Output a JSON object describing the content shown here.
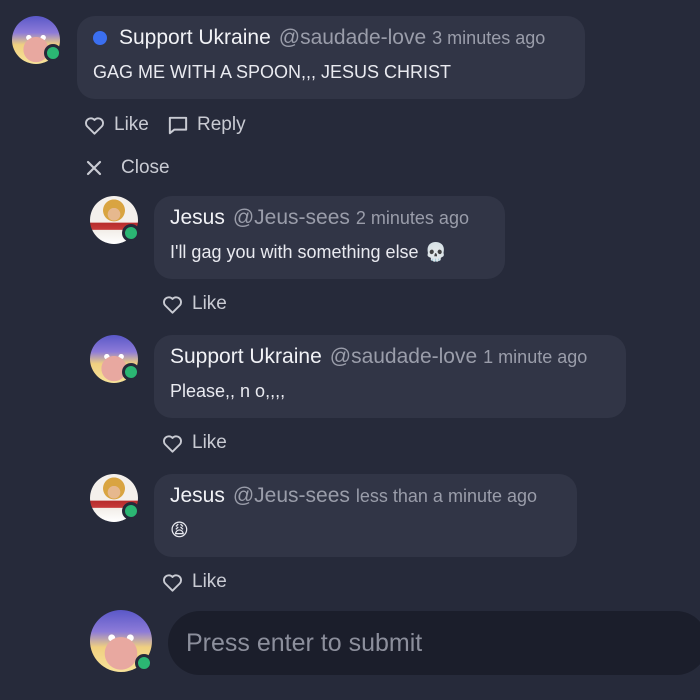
{
  "comments": [
    {
      "author": "Support Ukraine",
      "handle": "@saudade-love",
      "time": "3 minutes ago",
      "text": "GAG ME WITH A SPOON,,, JESUS CHRIST",
      "emoji": "",
      "actions": {
        "like": "Like",
        "reply": "Reply"
      }
    }
  ],
  "close_label": "Close",
  "replies": [
    {
      "author": "Jesus",
      "handle": "@Jeus-sees",
      "time": "2 minutes ago",
      "text": "I'll gag you with something else",
      "emoji": "💀",
      "like": "Like"
    },
    {
      "author": "Support Ukraine",
      "handle": "@saudade-love",
      "time": "1 minute ago",
      "text": "Please,, n o,,,,",
      "emoji": "",
      "like": "Like"
    },
    {
      "author": "Jesus",
      "handle": "@Jeus-sees",
      "time": "less than a minute ago",
      "text": "",
      "emoji": "😩",
      "like": "Like"
    }
  ],
  "composer": {
    "placeholder": "Press enter to submit"
  },
  "colors": {
    "background": "#262a3a",
    "bubble": "#313546",
    "online": "#2bb673",
    "unread_dot": "#3b6ff0",
    "input": "#1b1e2b"
  }
}
